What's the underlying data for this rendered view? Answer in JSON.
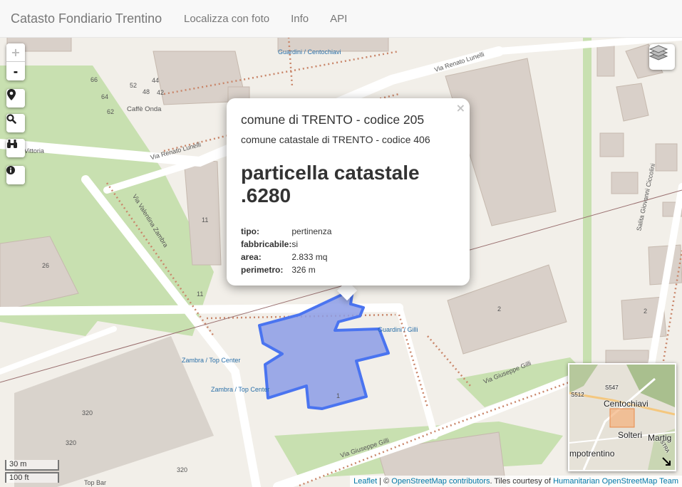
{
  "navbar": {
    "brand": "Catasto Fondiario Trentino",
    "links": [
      "Localizza con foto",
      "Info",
      "API"
    ]
  },
  "controls": {
    "zoom_in": "+",
    "zoom_out": "-"
  },
  "popup": {
    "close": "×",
    "comune": "comune di TRENTO - codice 205",
    "comune_catastale": "comune catastale di TRENTO - codice 406",
    "title_line1": "particella catastale",
    "title_line2": ".6280",
    "properties": [
      {
        "key": "tipo:",
        "value": "pertinenza"
      },
      {
        "key": "fabbricabile:",
        "value": "si"
      },
      {
        "key": "area:",
        "value": "2.833 mq"
      },
      {
        "key": "perimetro:",
        "value": "326 m"
      }
    ]
  },
  "map_labels": {
    "via_renato_lunelli_1": "Via Renato Lunelli",
    "via_renato_lunelli_2": "Via Renato Lunelli",
    "via_valentina_zambra": "Via Valentina Zambra",
    "via_giuseppe_gilli_1": "Via Giuseppe Gilli",
    "via_giuseppe_gilli_2": "Via Giuseppe Gilli",
    "salita_giovanni_ciccolini": "Salita Giovanni Ciccolini",
    "caffe_onda": "Caffè Onda",
    "guardini_centochiavi": "Guardini / Centochiavi",
    "guardini_gilli": "Guardini / Gilli",
    "zambra_top_center_1": "Zambra / Top Center",
    "zambra_top_center_2": "Zambra / Top Center",
    "top_bar": "Top Bar",
    "vittoria": "Vittoria",
    "house_numbers": [
      "66",
      "52",
      "44",
      "48",
      "42",
      "64",
      "62",
      "26",
      "11",
      "11",
      "2",
      "2",
      "1",
      "320",
      "320",
      "320"
    ]
  },
  "minimap": {
    "labels": [
      "S512",
      "S547",
      "Centochiavi",
      "Solteri",
      "Martig",
      "mpotrentino",
      "STRA"
    ]
  },
  "scale": {
    "metric": "30 m",
    "imperial": "100 ft"
  },
  "attribution": {
    "leaflet": "Leaflet",
    "separator": " | © ",
    "osm": "OpenStreetMap contributors",
    "tiles": ". Tiles courtesy of ",
    "hot": "Humanitarian OpenStreetMap Team"
  },
  "colors": {
    "parcel_fill": "#8c9ce6",
    "parcel_stroke": "#4a74f0",
    "park": "#c8e0b0",
    "building": "#d9d0c9"
  }
}
